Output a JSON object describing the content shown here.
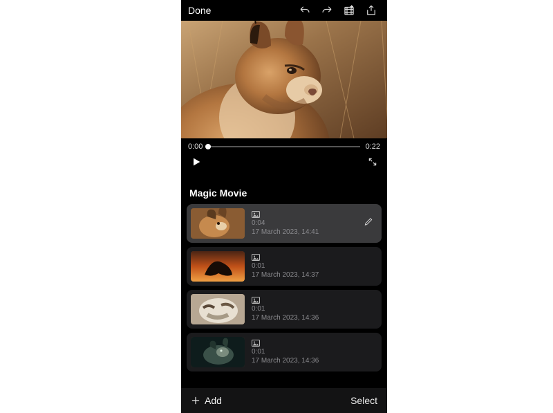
{
  "topbar": {
    "done": "Done"
  },
  "player": {
    "current_time": "0:00",
    "duration": "0:22"
  },
  "section": {
    "title": "Magic Movie"
  },
  "clips": [
    {
      "duration": "0:04",
      "date": "17 March 2023, 14:41",
      "selected": true
    },
    {
      "duration": "0:01",
      "date": "17 March 2023, 14:37",
      "selected": false
    },
    {
      "duration": "0:01",
      "date": "17 March 2023, 14:36",
      "selected": false
    },
    {
      "duration": "0:01",
      "date": "17 March 2023, 14:36",
      "selected": false
    }
  ],
  "bottombar": {
    "add": "Add",
    "select": "Select"
  }
}
